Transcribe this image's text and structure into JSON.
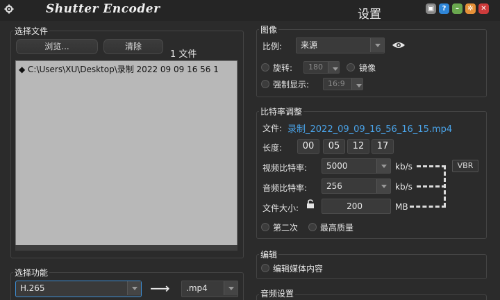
{
  "app": {
    "logo": "Shutter Encoder",
    "window_title": "设置"
  },
  "file_section": {
    "title": "选择文件",
    "browse_label": "浏览...",
    "clear_label": "清除",
    "file_count": "1 文件",
    "files": [
      "◆ C:\\Users\\XU\\Desktop\\录制 2022 09 09 16 56 1"
    ]
  },
  "function_section": {
    "title": "选择功能",
    "function_value": "H.265",
    "arrow": "⟶",
    "container_value": ".mp4"
  },
  "image_section": {
    "title": "图像",
    "ratio_label": "比例:",
    "ratio_value": "来源",
    "rotate_label": "旋转:",
    "rotate_value": "180",
    "mirror_label": "镜像",
    "force_display_label": "强制显示:",
    "force_display_value": "16:9"
  },
  "bitrate_section": {
    "title": "比特率调整",
    "file_label": "文件:",
    "file_name": "录制_2022_09_09_16_56_16_15.mp4",
    "duration_label": "长度:",
    "duration": [
      "00",
      "05",
      "12",
      "17"
    ],
    "video_bitrate_label": "视频比特率:",
    "video_bitrate_value": "5000",
    "video_unit": "kb/s",
    "vbr_label": "VBR",
    "audio_bitrate_label": "音频比特率:",
    "audio_bitrate_value": "256",
    "audio_unit": "kb/s",
    "file_size_label": "文件大小:",
    "file_size_value": "200",
    "size_unit": "MB",
    "second_pass_label": "第二次",
    "best_quality_label": "最高质量"
  },
  "edit_section": {
    "title": "编辑",
    "edit_media_label": "编辑媒体内容"
  },
  "audio_section": {
    "title": "音频设置"
  },
  "colors": {
    "accent_blue": "#3d8fd6",
    "link_blue": "#4aa3e8"
  }
}
